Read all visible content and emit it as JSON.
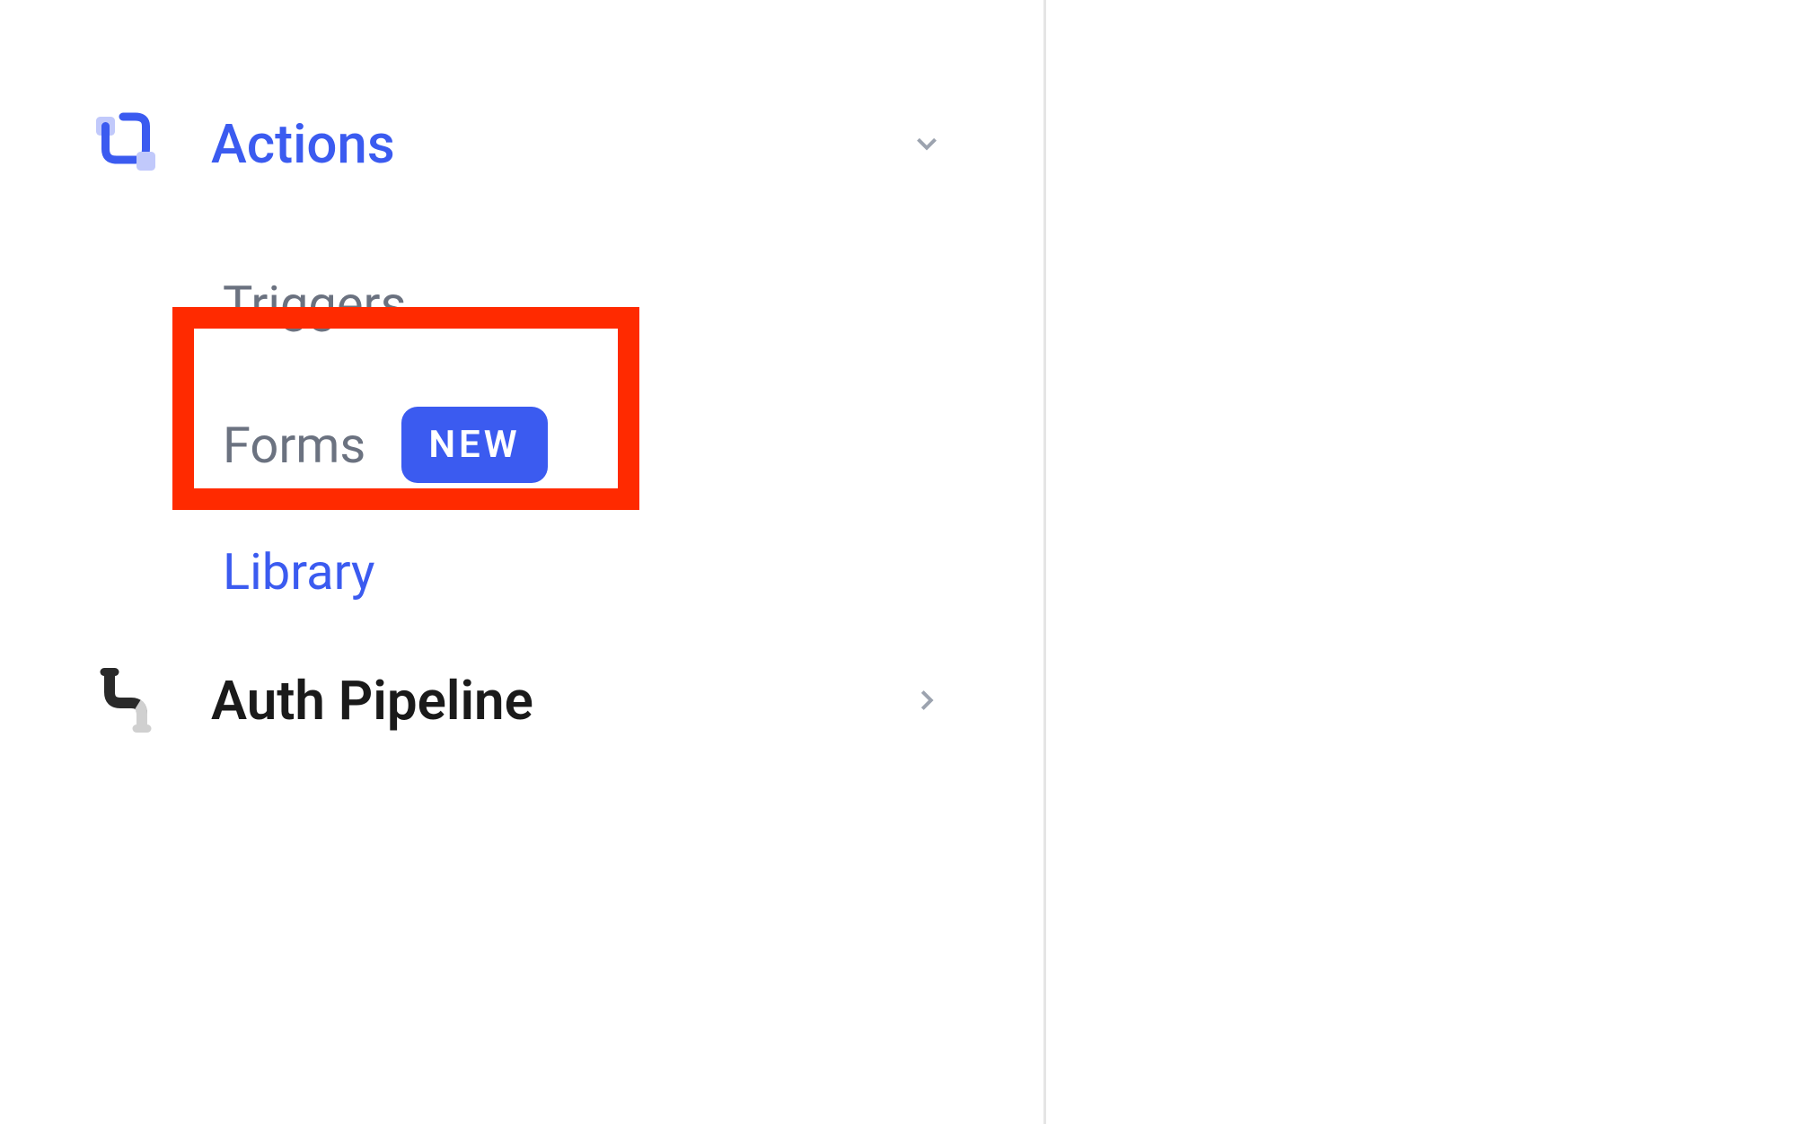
{
  "sidebar": {
    "sections": {
      "actions": {
        "label": "Actions",
        "expanded": true,
        "items": {
          "triggers": {
            "label": "Triggers"
          },
          "forms": {
            "label": "Forms",
            "badge": "NEW"
          },
          "library": {
            "label": "Library"
          }
        }
      },
      "authPipeline": {
        "label": "Auth Pipeline",
        "expanded": false
      }
    }
  },
  "colors": {
    "accent": "#3b5bf0",
    "highlight": "#ff2a00"
  }
}
